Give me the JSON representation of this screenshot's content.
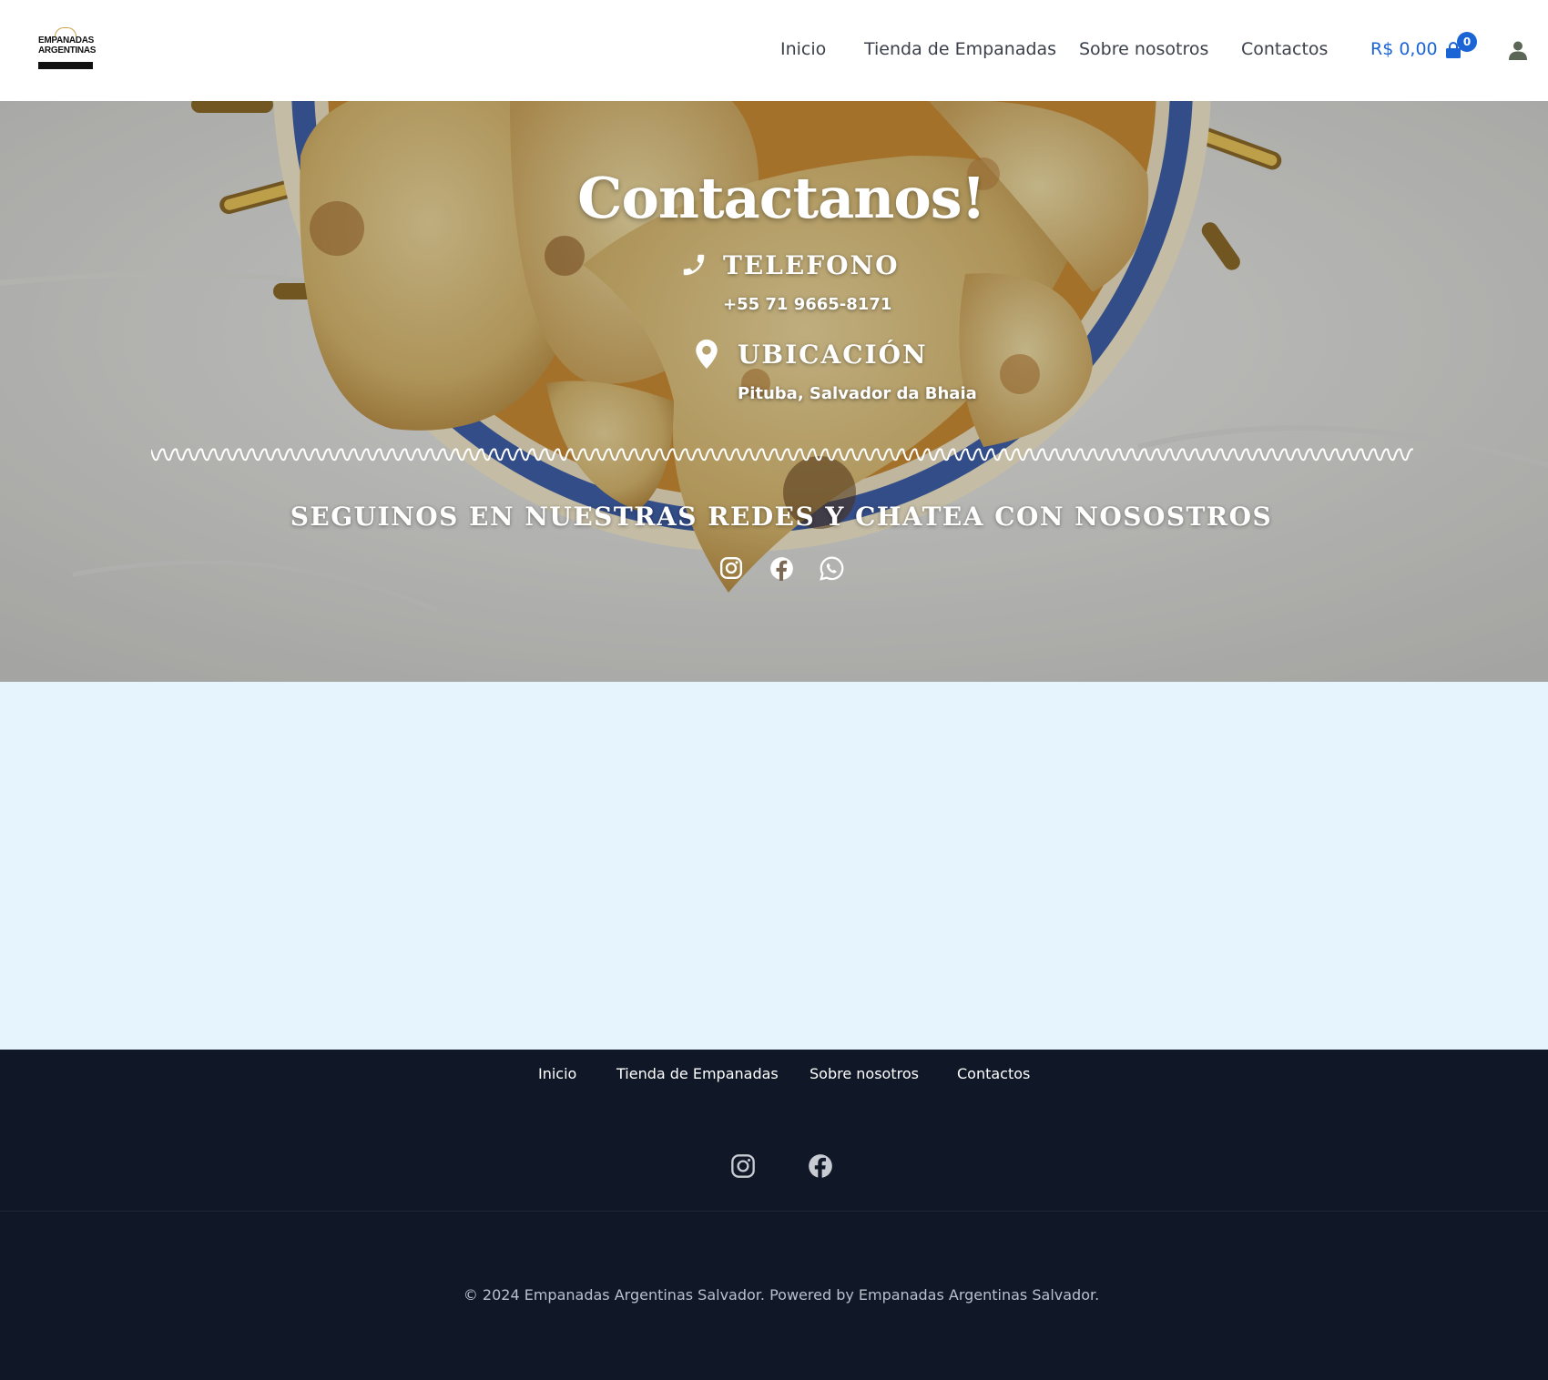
{
  "header": {
    "logo": {
      "line1": "EMPANADAS",
      "line2": "ARGENTINAS",
      "icon": "logo-sun-icon"
    },
    "nav": [
      {
        "label": "Inicio"
      },
      {
        "label": "Tienda de Empanadas"
      },
      {
        "label": "Sobre nosotros"
      },
      {
        "label": "Contactos"
      }
    ],
    "cart": {
      "total": "R$ 0,00",
      "count": "0",
      "icon": "shopping-bag-icon"
    },
    "account": {
      "icon": "user-icon"
    }
  },
  "hero": {
    "title": "Contactanos!",
    "phone": {
      "heading": "TELEFONO",
      "value": "+55 71 9665-8171",
      "icon": "phone-icon"
    },
    "location": {
      "heading": "UBICACIÓN",
      "value": "Pituba, Salvador da Bhaia",
      "icon": "map-pin-icon"
    },
    "follow": "SEGUINOS EN NUESTRAS REDES Y CHATEA CON NOSOSTROS",
    "social": [
      {
        "icon": "instagram-icon"
      },
      {
        "icon": "facebook-icon"
      },
      {
        "icon": "whatsapp-icon"
      }
    ]
  },
  "footer": {
    "nav": [
      {
        "label": "Inicio"
      },
      {
        "label": "Tienda de Empanadas"
      },
      {
        "label": "Sobre nosotros"
      },
      {
        "label": "Contactos"
      }
    ],
    "social": [
      {
        "icon": "instagram-icon"
      },
      {
        "icon": "facebook-icon"
      }
    ],
    "copyright": "© 2024 Empanadas Argentinas Salvador. Powered by Empanadas Argentinas Salvador."
  },
  "colors": {
    "accent": "#1a64d6",
    "footer_bg": "#101828",
    "light_section": "#e6f4fe"
  }
}
